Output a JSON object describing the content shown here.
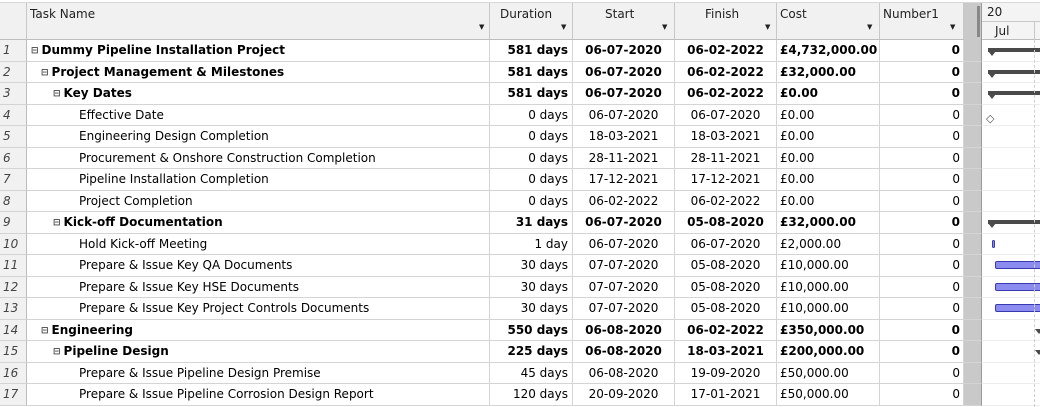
{
  "headers": {
    "task_name": "Task Name",
    "duration": "Duration",
    "start": "Start",
    "finish": "Finish",
    "cost": "Cost",
    "number1": "Number1",
    "timescale_top": "20",
    "timescale_bottom": "Jul"
  },
  "icons": {
    "collapse": "minus-box-icon",
    "dropdown": "dropdown-arrow-icon",
    "milestone": "diamond-icon"
  },
  "colors": {
    "header_bg": "#f1f1f1",
    "task_bar": "#8c8cf0",
    "summary_bar": "#4a4a4a"
  },
  "rows": [
    {
      "id": "1",
      "name": "Dummy Pipeline Installation Project",
      "level": 0,
      "summary": true,
      "duration": "581 days",
      "start": "06-07-2020",
      "finish": "06-02-2022",
      "cost": "£4,732,000.00",
      "number1": "0",
      "gantt": "summary"
    },
    {
      "id": "2",
      "name": "Project Management & Milestones",
      "level": 1,
      "summary": true,
      "duration": "581 days",
      "start": "06-07-2020",
      "finish": "06-02-2022",
      "cost": "£32,000.00",
      "number1": "0",
      "gantt": "summary"
    },
    {
      "id": "3",
      "name": "Key Dates",
      "level": 2,
      "summary": true,
      "duration": "581 days",
      "start": "06-07-2020",
      "finish": "06-02-2022",
      "cost": "£0.00",
      "number1": "0",
      "gantt": "summary"
    },
    {
      "id": "4",
      "name": "Effective Date",
      "level": 3,
      "summary": false,
      "duration": "0 days",
      "start": "06-07-2020",
      "finish": "06-07-2020",
      "cost": "£0.00",
      "number1": "0",
      "gantt": "milestone"
    },
    {
      "id": "5",
      "name": "Engineering Design Completion",
      "level": 3,
      "summary": false,
      "duration": "0 days",
      "start": "18-03-2021",
      "finish": "18-03-2021",
      "cost": "£0.00",
      "number1": "0",
      "gantt": "none"
    },
    {
      "id": "6",
      "name": "Procurement & Onshore Construction Completion",
      "level": 3,
      "summary": false,
      "duration": "0 days",
      "start": "28-11-2021",
      "finish": "28-11-2021",
      "cost": "£0.00",
      "number1": "0",
      "gantt": "none"
    },
    {
      "id": "7",
      "name": "Pipeline Installation Completion",
      "level": 3,
      "summary": false,
      "duration": "0 days",
      "start": "17-12-2021",
      "finish": "17-12-2021",
      "cost": "£0.00",
      "number1": "0",
      "gantt": "none"
    },
    {
      "id": "8",
      "name": "Project Completion",
      "level": 3,
      "summary": false,
      "duration": "0 days",
      "start": "06-02-2022",
      "finish": "06-02-2022",
      "cost": "£0.00",
      "number1": "0",
      "gantt": "none"
    },
    {
      "id": "9",
      "name": "Kick-off Documentation",
      "level": 2,
      "summary": true,
      "duration": "31 days",
      "start": "06-07-2020",
      "finish": "05-08-2020",
      "cost": "£32,000.00",
      "number1": "0",
      "gantt": "summary"
    },
    {
      "id": "10",
      "name": "Hold Kick-off Meeting",
      "level": 3,
      "summary": false,
      "duration": "1 day",
      "start": "06-07-2020",
      "finish": "06-07-2020",
      "cost": "£2,000.00",
      "number1": "0",
      "gantt": "short"
    },
    {
      "id": "11",
      "name": "Prepare & Issue Key QA Documents",
      "level": 3,
      "summary": false,
      "duration": "30 days",
      "start": "07-07-2020",
      "finish": "05-08-2020",
      "cost": "£10,000.00",
      "number1": "0",
      "gantt": "task"
    },
    {
      "id": "12",
      "name": "Prepare & Issue Key HSE Documents",
      "level": 3,
      "summary": false,
      "duration": "30 days",
      "start": "07-07-2020",
      "finish": "05-08-2020",
      "cost": "£10,000.00",
      "number1": "0",
      "gantt": "task"
    },
    {
      "id": "13",
      "name": "Prepare & Issue Key Project Controls Documents",
      "level": 3,
      "summary": false,
      "duration": "30 days",
      "start": "07-07-2020",
      "finish": "05-08-2020",
      "cost": "£10,000.00",
      "number1": "0",
      "gantt": "task"
    },
    {
      "id": "14",
      "name": "Engineering",
      "level": 1,
      "summary": true,
      "duration": "550 days",
      "start": "06-08-2020",
      "finish": "06-02-2022",
      "cost": "£350,000.00",
      "number1": "0",
      "gantt": "summary-late"
    },
    {
      "id": "15",
      "name": "Pipeline Design",
      "level": 2,
      "summary": true,
      "duration": "225 days",
      "start": "06-08-2020",
      "finish": "18-03-2021",
      "cost": "£200,000.00",
      "number1": "0",
      "gantt": "summary-late"
    },
    {
      "id": "16",
      "name": "Prepare & Issue Pipeline Design Premise",
      "level": 3,
      "summary": false,
      "duration": "45 days",
      "start": "06-08-2020",
      "finish": "19-09-2020",
      "cost": "£50,000.00",
      "number1": "0",
      "gantt": "none"
    },
    {
      "id": "17",
      "name": "Prepare & Issue Pipeline Corrosion Design Report",
      "level": 3,
      "summary": false,
      "duration": "120 days",
      "start": "20-09-2020",
      "finish": "17-01-2021",
      "cost": "£50,000.00",
      "number1": "0",
      "gantt": "none"
    }
  ]
}
